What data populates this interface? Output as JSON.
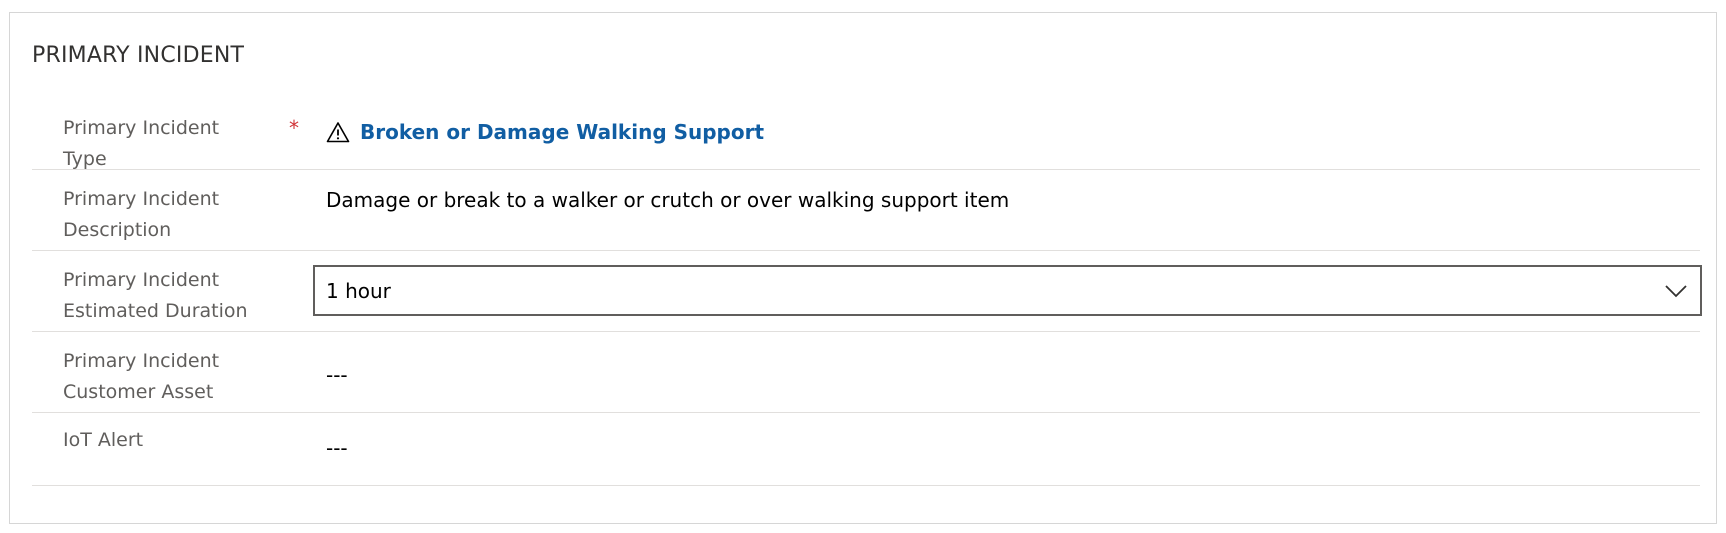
{
  "section": {
    "title": "PRIMARY INCIDENT"
  },
  "fields": {
    "incident_type": {
      "label": "Primary Incident Type",
      "required_marker": "*",
      "value": "Broken or Damage Walking Support",
      "icon": "warning-triangle-icon"
    },
    "description": {
      "label": "Primary Incident Description",
      "value": "Damage or break to a walker or crutch or over walking support item"
    },
    "estimated_duration": {
      "label": "Primary Incident Estimated Duration",
      "selected": "1 hour",
      "icon": "chevron-down-icon"
    },
    "customer_asset": {
      "label": "Primary Incident Customer Asset",
      "value": "---"
    },
    "iot_alert": {
      "label": "IoT Alert",
      "value": "---"
    }
  },
  "colors": {
    "link": "#115ea3",
    "required": "#d13438",
    "label": "#605e5c",
    "divider": "#e1dfdd"
  }
}
